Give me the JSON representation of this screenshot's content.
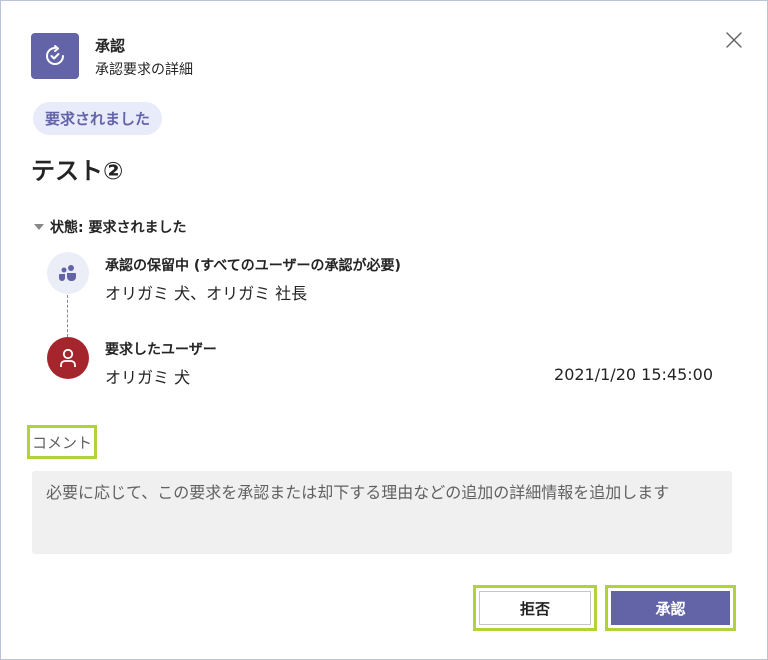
{
  "header": {
    "title": "承認",
    "subtitle": "承認要求の詳細",
    "app_icon": "approval-check-icon",
    "close_icon": "close-icon"
  },
  "status_badge": "要求されました",
  "request_title": "テスト②",
  "status_section": {
    "label": "状態: 要求されました"
  },
  "timeline": [
    {
      "icon": "people-icon",
      "title": "承認の保留中 (すべてのユーザーの承認が必要)",
      "body": "オリガミ 犬、オリガミ 社長"
    },
    {
      "icon": "person-icon",
      "title": "要求したユーザー",
      "body": "オリガミ 犬",
      "timestamp": "2021/1/20 15:45:00"
    }
  ],
  "comment": {
    "label": "コメント",
    "placeholder": "必要に応じて、この要求を承認または却下する理由などの追加の詳細情報を追加します"
  },
  "actions": {
    "reject_label": "拒否",
    "approve_label": "承認"
  },
  "colors": {
    "accent": "#6264a7",
    "badge_bg": "#e8ebfa",
    "user_avatar": "#a4262c",
    "highlight": "#b2d23a"
  }
}
